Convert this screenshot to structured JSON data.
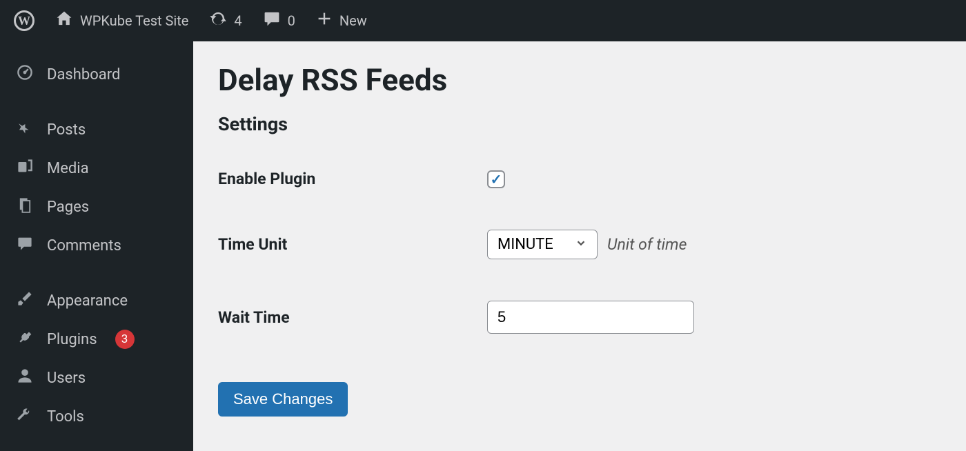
{
  "adminbar": {
    "siteName": "WPKube Test Site",
    "updatesCount": "4",
    "commentsCount": "0",
    "newLabel": "New"
  },
  "sidebar": {
    "dashboard": "Dashboard",
    "posts": "Posts",
    "media": "Media",
    "pages": "Pages",
    "comments": "Comments",
    "appearance": "Appearance",
    "plugins": "Plugins",
    "pluginsBadge": "3",
    "users": "Users",
    "tools": "Tools"
  },
  "page": {
    "title": "Delay RSS Feeds",
    "subtitle": "Settings",
    "fields": {
      "enableLabel": "Enable Plugin",
      "enableChecked": "✓",
      "timeUnitLabel": "Time Unit",
      "timeUnitValue": "MINUTE",
      "timeUnitHint": "Unit of time",
      "waitLabel": "Wait Time",
      "waitValue": "5"
    },
    "saveLabel": "Save Changes"
  }
}
